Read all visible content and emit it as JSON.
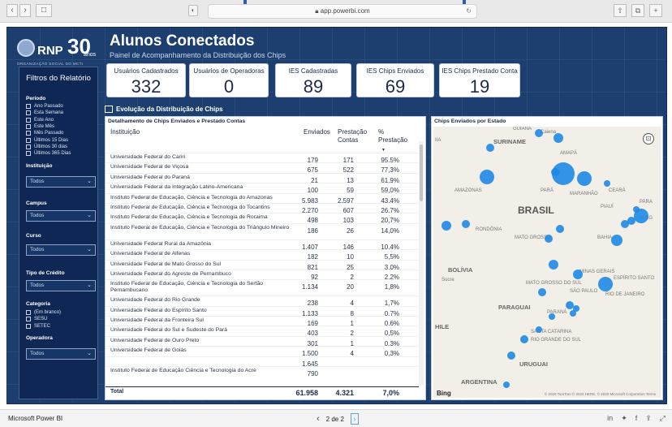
{
  "browser": {
    "url": "app.powerbi.com",
    "reload": "↻",
    "back": "‹",
    "forward": "›",
    "sidebar": "□",
    "share": "⇧",
    "tabs": "⧉",
    "newtab": "+"
  },
  "report": {
    "logo": {
      "text": "RNP",
      "thirty": "30",
      "anos": "anos",
      "org": "ORGANIZAÇÃO SOCIAL DO MCTI"
    },
    "title": "Alunos Conectados",
    "subtitle": "Painel de Acompanhamento da Distribuição dos Chips"
  },
  "filters": {
    "title": "Filtros do Relatório",
    "periodo": {
      "label": "Período",
      "options": [
        "Ano Passado",
        "Esta Semana",
        "Este Ano",
        "Este Mês",
        "Mês Passado",
        "Últimos 15 Dias",
        "Últimos 30 dias",
        "Últimos 365 Dias"
      ]
    },
    "instituicao": {
      "label": "Instituição",
      "value": "Todos"
    },
    "campus": {
      "label": "Campus",
      "value": "Todos"
    },
    "curso": {
      "label": "Curso",
      "value": "Todos"
    },
    "tipo_credito": {
      "label": "Tipo de Crédito",
      "value": "Todos"
    },
    "categoria": {
      "label": "Categoria",
      "options": [
        "(Em branco)",
        "SESU",
        "SETEC"
      ]
    },
    "operadora": {
      "label": "Operadora",
      "value": "Todos"
    }
  },
  "cards": [
    {
      "label": "Usuários Cadastrados",
      "value": "332"
    },
    {
      "label": "Usuários de Operadoras",
      "value": "0"
    },
    {
      "label": "IES Cadastradas",
      "value": "89"
    },
    {
      "label": "IES Chips Enviados",
      "value": "69"
    },
    {
      "label": "IES Chips Prestado Conta",
      "value": "19"
    }
  ],
  "section_header": "Evolução da Distribuição de Chips",
  "table": {
    "title": "Detalhamento de Chips Enviados e Prestado Contas",
    "headers": {
      "instituicao": "Instituição",
      "enviados": "Enviados",
      "prestacao_contas": "Prestação Contas",
      "pct_prestacao": "% Prestação"
    },
    "rows": [
      {
        "inst": "Universidade Federal do Cariri",
        "env": "179",
        "pre": "171",
        "pct": "95,5%"
      },
      {
        "inst": "Universidade Federal de Viçosa",
        "env": "675",
        "pre": "522",
        "pct": "77,3%"
      },
      {
        "inst": "Universidade Federal do Paraná",
        "env": "21",
        "pre": "13",
        "pct": "61,9%"
      },
      {
        "inst": "Universidade Federal da Integração Latino-Americana",
        "env": "100",
        "pre": "59",
        "pct": "59,0%"
      },
      {
        "inst": "Instituto Federal de Educação, Ciência e Tecnologia do Amazonas",
        "env": "5.983",
        "pre": "2.597",
        "pct": "43,4%"
      },
      {
        "inst": "Instituto Federal de Educação, Ciência e Tecnologia do Tocantins",
        "env": "2.270",
        "pre": "607",
        "pct": "26,7%"
      },
      {
        "inst": "Instituto Federal de Educação, Ciência e Tecnologia de Roraima",
        "env": "498",
        "pre": "103",
        "pct": "20,7%"
      },
      {
        "inst": "Instituto Federal de Educação, Ciência e Tecnologia do Triângulo Mineiro",
        "env": "186",
        "pre": "26",
        "pct": "14,0%",
        "tall": true
      },
      {
        "inst": "Universidade Federal Rural da Amazônia",
        "env": "1.407",
        "pre": "146",
        "pct": "10,4%"
      },
      {
        "inst": "Universidade Federal de Alfenas",
        "env": "182",
        "pre": "10",
        "pct": "5,5%"
      },
      {
        "inst": "Universidade Federal de Mato Grosso do Sul",
        "env": "821",
        "pre": "25",
        "pct": "3,0%"
      },
      {
        "inst": "Universidade Federal do Agreste de Pernambuco",
        "env": "92",
        "pre": "2",
        "pct": "2,2%"
      },
      {
        "inst": "Instituto Federal de Educação, Ciência e Tecnologia do Sertão Pernambucano",
        "env": "1.134",
        "pre": "20",
        "pct": "1,8%",
        "tall": true
      },
      {
        "inst": "Universidade Federal do Rio Grande",
        "env": "238",
        "pre": "4",
        "pct": "1,7%"
      },
      {
        "inst": "Universidade Federal do Espírito Santo",
        "env": "1.133",
        "pre": "8",
        "pct": "0,7%"
      },
      {
        "inst": "Universidade Federal da Fronteira Sul",
        "env": "169",
        "pre": "1",
        "pct": "0,6%"
      },
      {
        "inst": "Universidade Federal do Sul e Sudeste do Pará",
        "env": "403",
        "pre": "2",
        "pct": "0,5%"
      },
      {
        "inst": "Universidade Federal de Ouro Preto",
        "env": "301",
        "pre": "1",
        "pct": "0,3%"
      },
      {
        "inst": "Universidade Federal de Goiás",
        "env": "1.500",
        "pre": "4",
        "pct": "0,3%"
      },
      {
        "inst": "",
        "env": "1.645",
        "pre": "",
        "pct": ""
      },
      {
        "inst": "Instituto Federal de Educação Ciência e Tecnologia do Acre",
        "env": "790",
        "pre": "",
        "pct": ""
      }
    ],
    "total": {
      "label": "Total",
      "env": "61.958",
      "pre": "4.321",
      "pct": "7,0%"
    }
  },
  "map": {
    "title": "Chips Enviados por Estado",
    "labels": [
      "GUIANA",
      "Caiena",
      "SURINAME",
      "AMAPÁ",
      "IIA",
      "AMAZONAS",
      "PARÁ",
      "MARANHÃO",
      "CEARÁ",
      "BRASIL",
      "PIAUÍ",
      "PARA",
      "ALAG",
      "RONDÔNIA",
      "MATO GROSSO",
      "BAHIA",
      "BOLÍVIA",
      "Sucre",
      "MINAS GERAIS",
      "MATO GROSSO DO SUL",
      "SÃO PAULO",
      "RIO DE JANEIRO",
      "ESPÍRITO SANTO",
      "PARAGUAI",
      "PARANÁ",
      "HILE",
      "SANTA CATARINA",
      "RIO GRANDE DO SUL",
      "URUGUAI",
      "ARGENTINA"
    ],
    "bing": "Bing",
    "copyright": "© 2020 TomTom © 2020 HERE, © 2020 Microsoft Corporation  Terms"
  },
  "status": {
    "app": "Microsoft Power BI",
    "pager": "2 de 2",
    "prev": "‹",
    "next": "›"
  },
  "colors": {
    "accent": "#1e88e5",
    "background": "#1d3f70",
    "sidebar": "#0e2754"
  }
}
